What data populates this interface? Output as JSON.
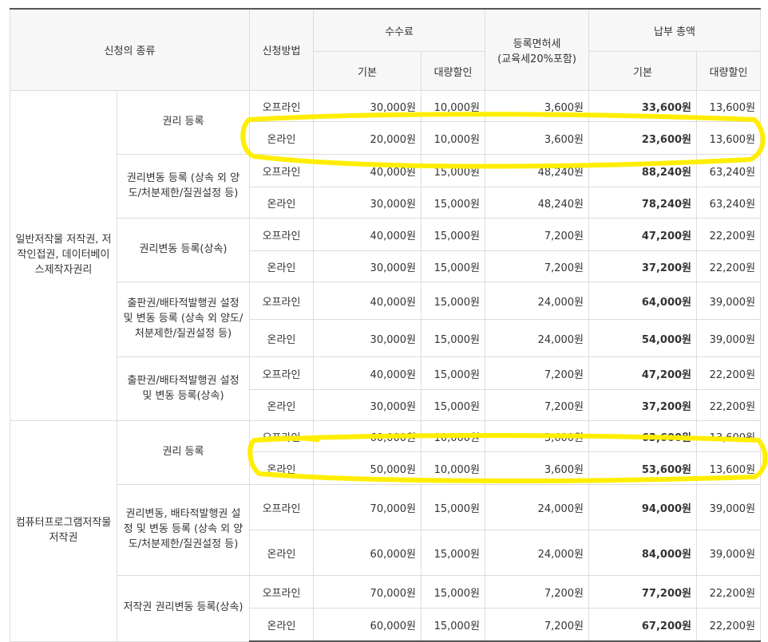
{
  "header": {
    "type": "신청의 종류",
    "method": "신청방법",
    "fee": "수수료",
    "fee_basic": "기본",
    "fee_bulk": "대량할인",
    "tax_line1": "등록면허세",
    "tax_line2": "(교육세20%포함)",
    "total": "납부 총액",
    "total_basic": "기본",
    "total_bulk": "대량할인"
  },
  "group1": {
    "name": "일반저작물 저작권, 저작인접권, 데이터베이스제작자권리",
    "types": [
      {
        "label": "권리 등록",
        "rows": [
          {
            "method": "오프라인",
            "fee": "30,000원",
            "bulk": "10,000원",
            "tax": "3,600원",
            "total": "33,600원",
            "total_bulk": "13,600원"
          },
          {
            "method": "온라인",
            "fee": "20,000원",
            "bulk": "10,000원",
            "tax": "3,600원",
            "total": "23,600원",
            "total_bulk": "13,600원"
          }
        ]
      },
      {
        "label": "권리변동 등록 (상속 외 양도/처분제한/질권설정 등)",
        "rows": [
          {
            "method": "오프라인",
            "fee": "40,000원",
            "bulk": "15,000원",
            "tax": "48,240원",
            "total": "88,240원",
            "total_bulk": "63,240원"
          },
          {
            "method": "온라인",
            "fee": "30,000원",
            "bulk": "15,000원",
            "tax": "48,240원",
            "total": "78,240원",
            "total_bulk": "63,240원"
          }
        ]
      },
      {
        "label": "권리변동 등록(상속)",
        "rows": [
          {
            "method": "오프라인",
            "fee": "40,000원",
            "bulk": "15,000원",
            "tax": "7,200원",
            "total": "47,200원",
            "total_bulk": "22,200원"
          },
          {
            "method": "온라인",
            "fee": "30,000원",
            "bulk": "15,000원",
            "tax": "7,200원",
            "total": "37,200원",
            "total_bulk": "22,200원"
          }
        ]
      },
      {
        "label": "출판권/배타적발행권 설정 및 변동 등록 (상속 외 양도/처분제한/질권설정 등)",
        "rows": [
          {
            "method": "오프라인",
            "fee": "40,000원",
            "bulk": "15,000원",
            "tax": "24,000원",
            "total": "64,000원",
            "total_bulk": "39,000원"
          },
          {
            "method": "온라인",
            "fee": "30,000원",
            "bulk": "15,000원",
            "tax": "24,000원",
            "total": "54,000원",
            "total_bulk": "39,000원"
          }
        ]
      },
      {
        "label": "출판권/배타적발행권 설정 및 변동 등록(상속)",
        "rows": [
          {
            "method": "오프라인",
            "fee": "40,000원",
            "bulk": "15,000원",
            "tax": "7,200원",
            "total": "47,200원",
            "total_bulk": "22,200원"
          },
          {
            "method": "온라인",
            "fee": "30,000원",
            "bulk": "15,000원",
            "tax": "7,200원",
            "total": "37,200원",
            "total_bulk": "22,200원"
          }
        ]
      }
    ]
  },
  "group2": {
    "name": "컴퓨터프로그램저작물 저작권",
    "types": [
      {
        "label": "권리 등록",
        "rows": [
          {
            "method": "오프라인",
            "fee": "60,000원",
            "bulk": "10,000원",
            "tax": "3,600원",
            "total": "63,600원",
            "total_bulk": "13,600원"
          },
          {
            "method": "온라인",
            "fee": "50,000원",
            "bulk": "10,000원",
            "tax": "3,600원",
            "total": "53,600원",
            "total_bulk": "13,600원"
          }
        ]
      },
      {
        "label": "권리변동, 배타적발행권 설정 및 변동 등록 (상속 외 양도/처분제한/질권설정 등)",
        "rows": [
          {
            "method": "오프라인",
            "fee": "70,000원",
            "bulk": "15,000원",
            "tax": "24,000원",
            "total": "94,000원",
            "total_bulk": "39,000원"
          },
          {
            "method": "온라인",
            "fee": "60,000원",
            "bulk": "15,000원",
            "tax": "24,000원",
            "total": "84,000원",
            "total_bulk": "39,000원"
          }
        ]
      },
      {
        "label": "저작권 권리변동 등록(상속)",
        "rows": [
          {
            "method": "오프라인",
            "fee": "70,000원",
            "bulk": "15,000원",
            "tax": "7,200원",
            "total": "77,200원",
            "total_bulk": "22,200원"
          },
          {
            "method": "온라인",
            "fee": "60,000원",
            "bulk": "15,000원",
            "tax": "7,200원",
            "total": "67,200원",
            "total_bulk": "22,200원"
          }
        ]
      }
    ]
  },
  "highlight_color": "#ffee00"
}
